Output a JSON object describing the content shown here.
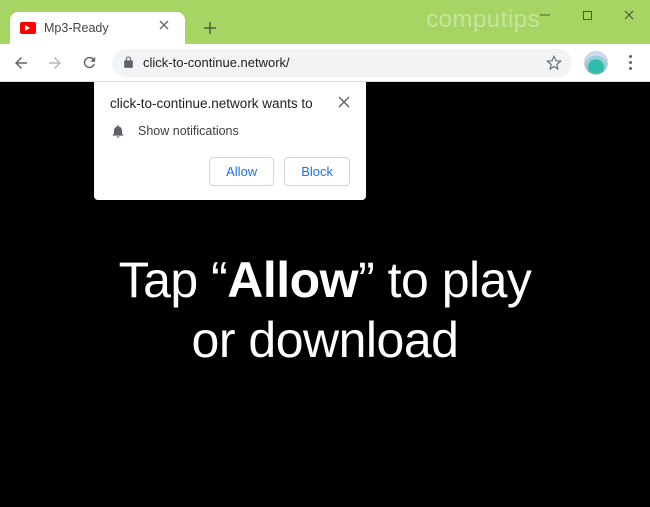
{
  "window": {
    "watermark": "computips"
  },
  "tab": {
    "title": "Mp3-Ready"
  },
  "address": {
    "url": "click-to-continue.network/"
  },
  "permission": {
    "origin_line": "click-to-continue.network wants to",
    "capability": "Show notifications",
    "allow": "Allow",
    "block": "Block"
  },
  "page": {
    "line1_a": "Tap “",
    "line1_b": "Allow",
    "line1_c": "” to play",
    "line2": "or download"
  }
}
